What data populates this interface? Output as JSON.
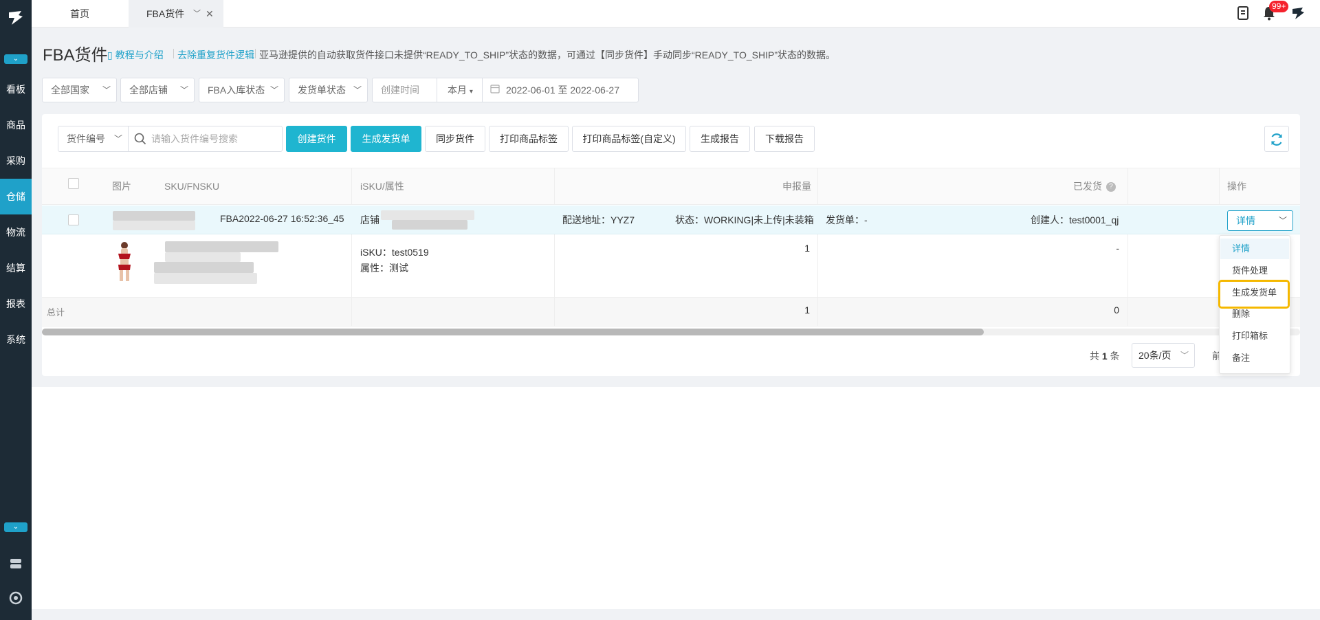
{
  "tabs": {
    "home": "首页",
    "active": "FBA货件"
  },
  "notifications": {
    "badge": "99+"
  },
  "sidebar": {
    "items": [
      "看板",
      "商品",
      "采购",
      "仓储",
      "物流",
      "结算",
      "报表",
      "系统"
    ],
    "active_index": 3
  },
  "header": {
    "title": "FBA货件",
    "tutorial_link": "教程与介绍",
    "dedupe_link": "去除重复货件逻辑",
    "description": "亚马逊提供的自动获取货件接口未提供“READY_TO_SHIP”状态的数据，可通过【同步货件】手动同步“READY_TO_SHIP”状态的数据。"
  },
  "filters": {
    "country": "全部国家",
    "store": "全部店铺",
    "fba_status": "FBA入库状态",
    "ship_status": "发货单状态",
    "date_label": "创建时间",
    "date_range": "本月",
    "date_value": "2022-06-01 至 2022-06-27"
  },
  "toolbar": {
    "search_type": "货件编号",
    "search_placeholder": "请输入货件编号搜索",
    "buttons": [
      "创建货件",
      "生成发货单",
      "同步货件",
      "打印商品标签",
      "打印商品标签(自定义)",
      "生成报告",
      "下载报告"
    ]
  },
  "table": {
    "columns": {
      "image": "图片",
      "sku": "SKU/FNSKU",
      "isku": "iSKU/属性",
      "declared": "申报量",
      "shipped": "已发货",
      "ops": "操作"
    },
    "group": {
      "shipment_name": "FBA2022-06-27 16:52:36_45",
      "store_label": "店铺",
      "address": "配送地址：YYZ7",
      "status": "状态：WORKING|未上传|未装箱",
      "ship_order": "发货单：-",
      "creator": "创建人：test0001_qj",
      "detail_button": "详情"
    },
    "item": {
      "isku": "iSKU：test0519",
      "attr": "属性：测试",
      "declared": "1",
      "shipped": "-"
    },
    "total": {
      "label": "总计",
      "declared": "1",
      "shipped": "0"
    }
  },
  "pagination": {
    "total_prefix": "共",
    "total_count": "1",
    "total_suffix": "条",
    "page_size": "20条/页",
    "prev_partial": "前"
  },
  "dropdown": {
    "items": [
      "详情",
      "货件处理",
      "生成发货单",
      "删除",
      "打印箱标",
      "备注"
    ],
    "highlighted_index": 2
  },
  "colors": {
    "accent": "#1fa1c9",
    "primary_button": "#1fb5d0",
    "sidebar": "#1d2b36",
    "highlight_border": "#f5b800",
    "badge": "#f5222d"
  }
}
